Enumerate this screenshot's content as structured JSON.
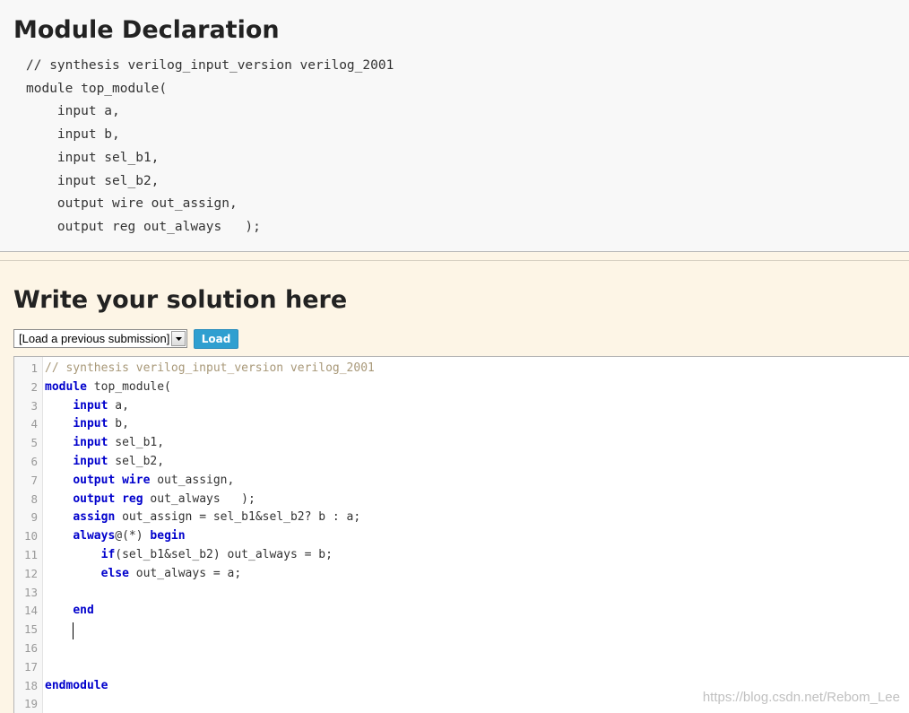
{
  "declaration": {
    "heading": "Module Declaration",
    "code_lines": [
      "// synthesis verilog_input_version verilog_2001",
      "module top_module(",
      "    input a,",
      "    input b,",
      "    input sel_b1,",
      "    input sel_b2,",
      "    output wire out_assign,",
      "    output reg out_always   );"
    ]
  },
  "solution": {
    "heading": "Write your solution here",
    "select_value": "[Load a previous submission]",
    "load_label": "Load"
  },
  "editor": {
    "lines": [
      [
        {
          "t": "cm",
          "s": "// synthesis verilog_input_version verilog_2001"
        }
      ],
      [
        {
          "t": "kw",
          "s": "module"
        },
        {
          "t": "",
          "s": " top_module("
        }
      ],
      [
        {
          "t": "",
          "s": "    "
        },
        {
          "t": "kw",
          "s": "input"
        },
        {
          "t": "",
          "s": " a,"
        }
      ],
      [
        {
          "t": "",
          "s": "    "
        },
        {
          "t": "kw",
          "s": "input"
        },
        {
          "t": "",
          "s": " b,"
        }
      ],
      [
        {
          "t": "",
          "s": "    "
        },
        {
          "t": "kw",
          "s": "input"
        },
        {
          "t": "",
          "s": " sel_b1,"
        }
      ],
      [
        {
          "t": "",
          "s": "    "
        },
        {
          "t": "kw",
          "s": "input"
        },
        {
          "t": "",
          "s": " sel_b2,"
        }
      ],
      [
        {
          "t": "",
          "s": "    "
        },
        {
          "t": "kw",
          "s": "output wire"
        },
        {
          "t": "",
          "s": " out_assign,"
        }
      ],
      [
        {
          "t": "",
          "s": "    "
        },
        {
          "t": "kw",
          "s": "output reg"
        },
        {
          "t": "",
          "s": " out_always   );"
        }
      ],
      [
        {
          "t": "",
          "s": "    "
        },
        {
          "t": "kw",
          "s": "assign"
        },
        {
          "t": "",
          "s": " out_assign = sel_b1&sel_b2? b : a;"
        }
      ],
      [
        {
          "t": "",
          "s": "    "
        },
        {
          "t": "kw",
          "s": "always"
        },
        {
          "t": "",
          "s": "@(*) "
        },
        {
          "t": "kw",
          "s": "begin"
        }
      ],
      [
        {
          "t": "",
          "s": "        "
        },
        {
          "t": "kw",
          "s": "if"
        },
        {
          "t": "",
          "s": "(sel_b1&sel_b2) out_always = b;"
        }
      ],
      [
        {
          "t": "",
          "s": "        "
        },
        {
          "t": "kw",
          "s": "else"
        },
        {
          "t": "",
          "s": " out_always = a;"
        }
      ],
      [],
      [
        {
          "t": "",
          "s": "    "
        },
        {
          "t": "kw",
          "s": "end"
        }
      ],
      [],
      [],
      [],
      [
        {
          "t": "kw",
          "s": "endmodule"
        }
      ],
      []
    ]
  },
  "watermark": "https://blog.csdn.net/Rebom_Lee",
  "colors": {
    "keyword": "#0000cc",
    "comment": "#a89878",
    "load_button": "#2f9fd0",
    "solution_bg": "#fdf5e6"
  }
}
